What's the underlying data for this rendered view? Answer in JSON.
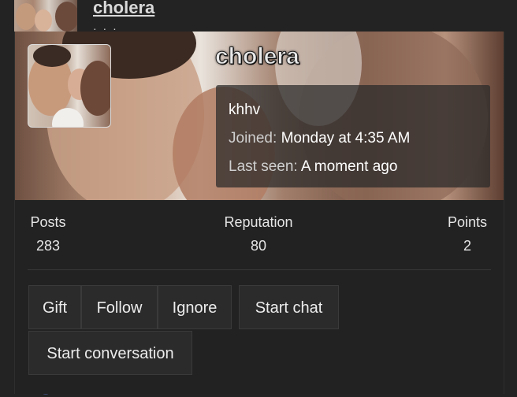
{
  "background": {
    "username": "cholera",
    "dots": "· · ·",
    "bottom_link": "cholera"
  },
  "card": {
    "username": "cholera",
    "user_title": "khhv",
    "joined_label": "Joined:",
    "joined_value": "Monday at 4:35 AM",
    "last_seen_label": "Last seen:",
    "last_seen_value": "A moment ago"
  },
  "stats": [
    {
      "label": "Posts",
      "value": "283"
    },
    {
      "label": "Reputation",
      "value": "80"
    },
    {
      "label": "Points",
      "value": "2"
    }
  ],
  "actions": {
    "gift": "Gift",
    "follow": "Follow",
    "ignore": "Ignore",
    "start_chat": "Start chat",
    "start_conversation": "Start conversation"
  },
  "colors": {
    "page_bg": "#232323",
    "card_bg": "#222222",
    "button_bg": "#2b2b2b",
    "link_blue": "#5d6d93"
  }
}
